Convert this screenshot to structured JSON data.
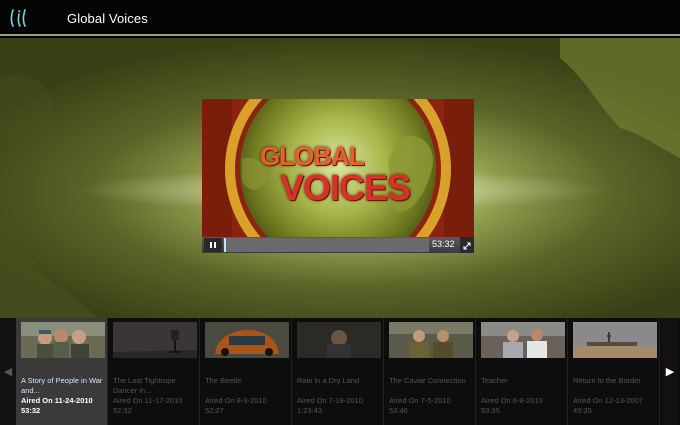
{
  "header": {
    "logo_text": "lil",
    "show_title": "Global Voices"
  },
  "player": {
    "video_logo": {
      "line1": "GLOBAL",
      "line2": "VOICES"
    },
    "duration": "53:32",
    "progress_fraction": 0.01
  },
  "carousel": {
    "episodes": [
      {
        "title": "A Story of People in War and...",
        "aired": "Aired On 11-24-2010",
        "duration": "53:32",
        "active": true
      },
      {
        "title": "The Last Tightrope Dancer in...",
        "aired": "Aired On 11-17-2010",
        "duration": "52:32",
        "active": false
      },
      {
        "title": "The Beetle",
        "aired": "Aired On 8-3-2010",
        "duration": "52:27",
        "active": false
      },
      {
        "title": "Rain in a Dry Land",
        "aired": "Aired On 7-19-2010",
        "duration": "1:23:43",
        "active": false
      },
      {
        "title": "The Caviar Connection",
        "aired": "Aired On 7-5-2010",
        "duration": "53:46",
        "active": false
      },
      {
        "title": "Teacher",
        "aired": "Aired On 6-8-2010",
        "duration": "53:35",
        "active": false
      },
      {
        "title": "Return to the Border",
        "aired": "Aired On 12-13-2007",
        "duration": "49:35",
        "active": false
      }
    ]
  },
  "colors": {
    "header_border": "#9aa08a",
    "progress_fill": "#bfe3f2",
    "active_item_bg": "#3a3a3a"
  },
  "icons": {
    "logo": "lil-logo-icon",
    "pause": "pause-icon",
    "fullscreen": "fullscreen-icon",
    "prev": "chevron-left-icon",
    "next": "chevron-right-icon"
  }
}
